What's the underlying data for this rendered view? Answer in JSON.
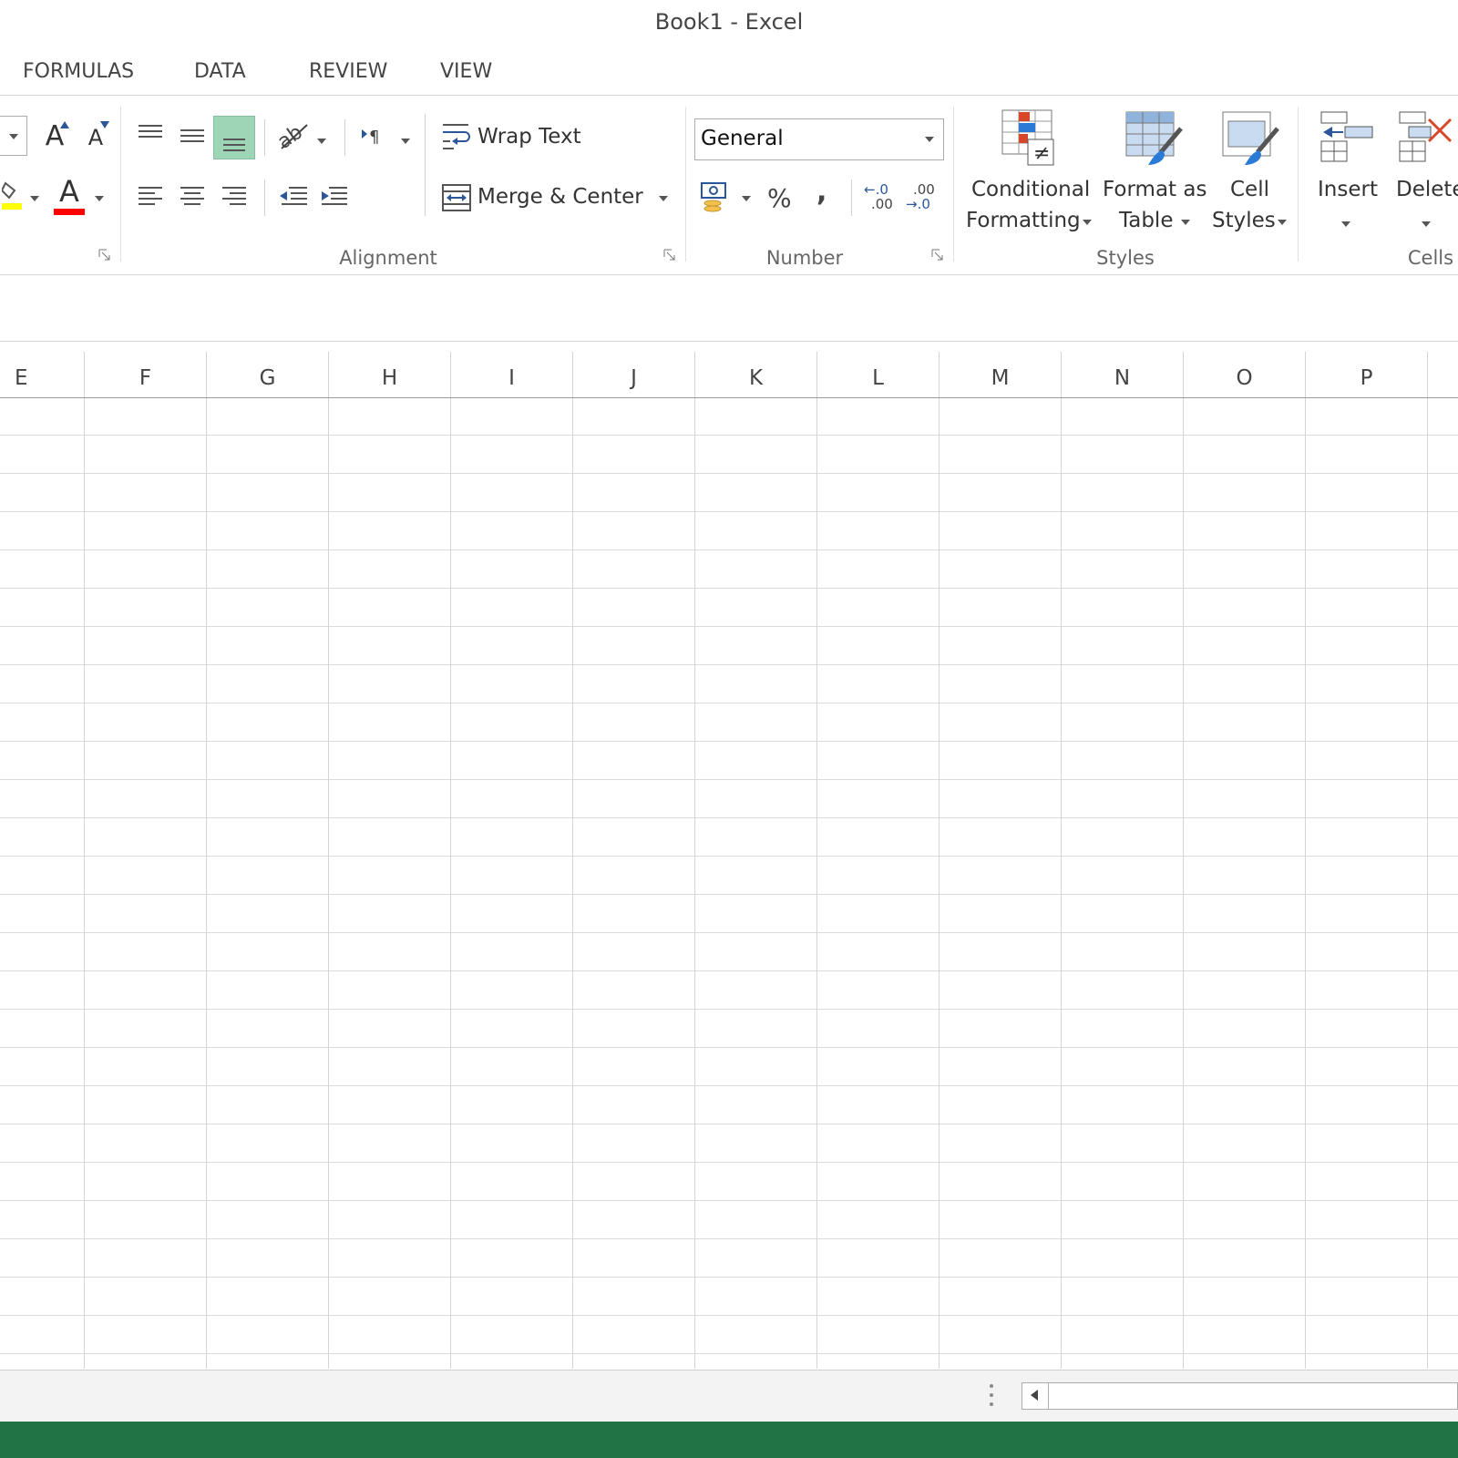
{
  "window": {
    "title": "Book1 - Excel"
  },
  "tabs": [
    {
      "label": "FORMULAS"
    },
    {
      "label": "DATA"
    },
    {
      "label": "REVIEW"
    },
    {
      "label": "VIEW"
    }
  ],
  "ribbon": {
    "alignment": {
      "label": "Alignment",
      "wrap_text": "Wrap Text",
      "merge_center": "Merge & Center"
    },
    "number": {
      "label": "Number",
      "format_value": "General",
      "percent": "%",
      "comma": ",",
      "inc_decimal_top": "←.0",
      "inc_decimal_bottom": ".00",
      "dec_decimal_top": ".00",
      "dec_decimal_bottom": "→.0"
    },
    "styles": {
      "label": "Styles",
      "conditional_line1": "Conditional",
      "conditional_line2": "Formatting",
      "format_table_line1": "Format as",
      "format_table_line2": "Table",
      "cell_styles_line1": "Cell",
      "cell_styles_line2": "Styles"
    },
    "cells": {
      "label": "Cells",
      "insert": "Insert",
      "delete": "Delete"
    },
    "font": {
      "grow_font": "A",
      "shrink_font": "A",
      "font_color": "A"
    }
  },
  "columns": [
    "E",
    "F",
    "G",
    "H",
    "I",
    "J",
    "K",
    "L",
    "M",
    "N",
    "O",
    "P"
  ],
  "colors": {
    "accent": "#217346",
    "fill_yellow": "#ffff00",
    "font_red": "#ff0000"
  }
}
